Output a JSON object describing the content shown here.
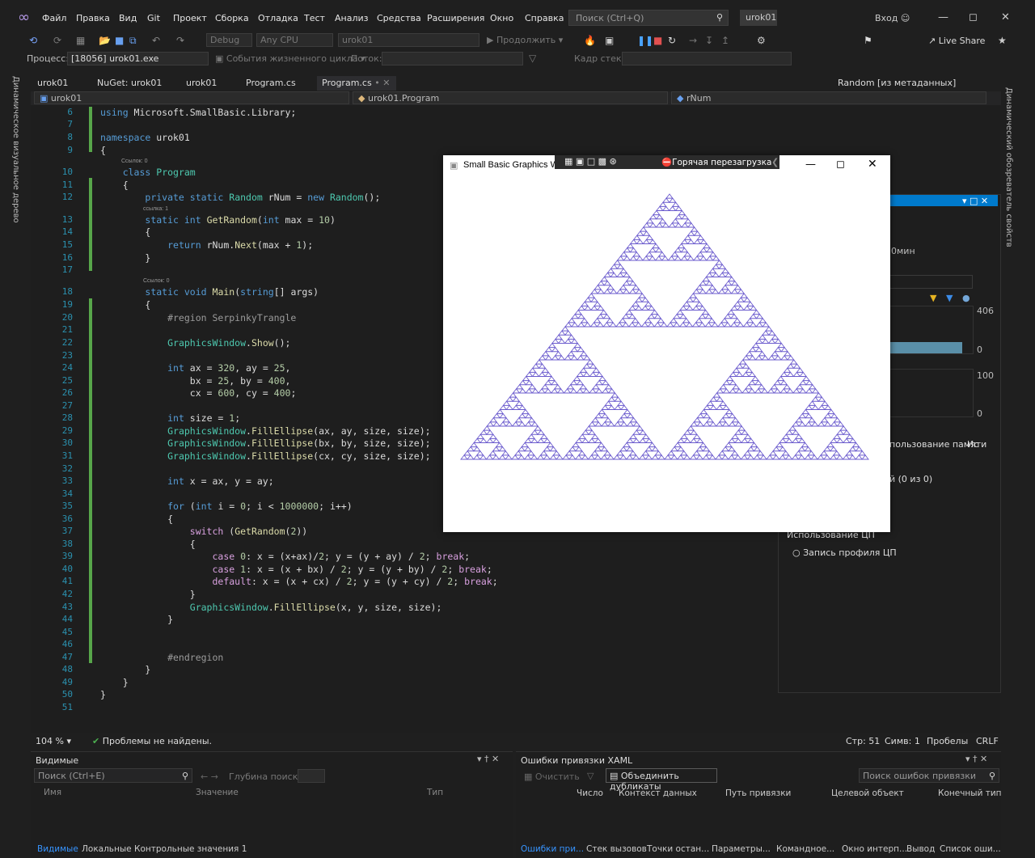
{
  "titlebar": {
    "menu": [
      "Файл",
      "Правка",
      "Вид",
      "Git",
      "Проект",
      "Сборка",
      "Отладка",
      "Тест",
      "Анализ",
      "Средства",
      "Расширения",
      "Окно",
      "Справка"
    ],
    "search_placeholder": "Поиск (Ctrl+Q)",
    "solution": "urok01",
    "signin": "Вход"
  },
  "toolbar": {
    "config": "Debug",
    "platform": "Any CPU",
    "startup": "urok01",
    "continue": "Продолжить",
    "live_share": "Live Share",
    "process_label": "Процесс:",
    "process_value": "[18056] urok01.exe",
    "lifecycle": "События жизненного цикла",
    "thread_label": "Поток:",
    "stackframe_label": "Кадр стека:"
  },
  "side": {
    "left_label": "Динамическое визуальное дерево",
    "right_label": "Динамический обозреватель свойств"
  },
  "tabs": [
    "urok01",
    "NuGet: urok01",
    "urok01",
    "Program.cs",
    "Program.cs"
  ],
  "tab_random": "Random [из метаданных]",
  "nav": {
    "project": "urok01",
    "class": "urok01.Program",
    "member": "rNum"
  },
  "code_lines": [
    {
      "n": "6",
      "t": "using Microsoft.SmallBasic.Library;"
    },
    {
      "n": "7",
      "t": ""
    },
    {
      "n": "8",
      "t": "namespace urok01"
    },
    {
      "n": "9",
      "t": "{"
    },
    {
      "n": "10",
      "t": "    class Program"
    },
    {
      "n": "11",
      "t": "    {"
    },
    {
      "n": "12",
      "t": "        private static Random rNum = new Random();"
    },
    {
      "n": "13",
      "t": "        static int GetRandom(int max = 10)"
    },
    {
      "n": "14",
      "t": "        {"
    },
    {
      "n": "15",
      "t": "            return rNum.Next(max + 1);"
    },
    {
      "n": "16",
      "t": "        }"
    },
    {
      "n": "17",
      "t": ""
    },
    {
      "n": "18",
      "t": "        static void Main(string[] args)"
    },
    {
      "n": "19",
      "t": "        {"
    },
    {
      "n": "20",
      "t": "            #region SerpinkyTrangle"
    },
    {
      "n": "21",
      "t": ""
    },
    {
      "n": "22",
      "t": "            GraphicsWindow.Show();"
    },
    {
      "n": "23",
      "t": ""
    },
    {
      "n": "24",
      "t": "            int ax = 320, ay = 25,"
    },
    {
      "n": "25",
      "t": "                bx = 25, by = 400,"
    },
    {
      "n": "26",
      "t": "                cx = 600, cy = 400;"
    },
    {
      "n": "27",
      "t": ""
    },
    {
      "n": "28",
      "t": "            int size = 1;"
    },
    {
      "n": "29",
      "t": "            GraphicsWindow.FillEllipse(ax, ay, size, size);"
    },
    {
      "n": "30",
      "t": "            GraphicsWindow.FillEllipse(bx, by, size, size);"
    },
    {
      "n": "31",
      "t": "            GraphicsWindow.FillEllipse(cx, cy, size, size);"
    },
    {
      "n": "32",
      "t": ""
    },
    {
      "n": "33",
      "t": "            int x = ax, y = ay;"
    },
    {
      "n": "34",
      "t": ""
    },
    {
      "n": "35",
      "t": "            for (int i = 0; i < 1000000; i++)"
    },
    {
      "n": "36",
      "t": "            {"
    },
    {
      "n": "37",
      "t": "                switch (GetRandom(2))"
    },
    {
      "n": "38",
      "t": "                {"
    },
    {
      "n": "39",
      "t": "                    case 0: x = (x+ax)/2; y = (y + ay) / 2; break;"
    },
    {
      "n": "40",
      "t": "                    case 1: x = (x + bx) / 2; y = (y + by) / 2; break;"
    },
    {
      "n": "41",
      "t": "                    default: x = (x + cx) / 2; y = (y + cy) / 2; break;"
    },
    {
      "n": "42",
      "t": "                }"
    },
    {
      "n": "43",
      "t": "                GraphicsWindow.FillEllipse(x, y, size, size);"
    },
    {
      "n": "44",
      "t": "            }"
    },
    {
      "n": "45",
      "t": ""
    },
    {
      "n": "46",
      "t": ""
    },
    {
      "n": "47",
      "t": "            #endregion"
    },
    {
      "n": "48",
      "t": "        }"
    },
    {
      "n": "49",
      "t": "    }"
    },
    {
      "n": "50",
      "t": "}"
    },
    {
      "n": "51",
      "t": ""
    }
  ],
  "refs": {
    "r10": "Ссылок: 0",
    "r12": "ссылка: 1",
    "r18": "Ссылок: 0"
  },
  "status": {
    "zoom": "104 %",
    "problems": "Проблемы не найдены.",
    "line": "Стр: 51",
    "col": "Симв: 1",
    "ws": "Пробелы",
    "eol": "CRLF"
  },
  "gfx": {
    "title": "Small Basic Graphics Wi",
    "hot_reload": "Горячая перезагрузка",
    "fill_color": "#6a5acd"
  },
  "diag": {
    "min": "0мин",
    "v406": "406",
    "v0a": "0",
    "v100": "100",
    "v0b": "0",
    "mem": "пользование памяти",
    "io": "Ис",
    "objs": "й (0 из 0)",
    "cpu_header": "Использование ЦП",
    "cpu_record": "Запись профиля ЦП"
  },
  "watch": {
    "title": "Видимые",
    "search": "Поиск (Ctrl+E)",
    "depth": "Глубина поиска:",
    "cols": [
      "Имя",
      "Значение",
      "Тип"
    ],
    "tabs": [
      "Видимые",
      "Локальные",
      "Контрольные значения 1"
    ]
  },
  "xaml": {
    "title": "Ошибки привязки XAML",
    "clear": "Очистить",
    "merge": "Объединить дубликаты",
    "search": "Поиск ошибок привязки",
    "cols": [
      "Число",
      "Контекст данных",
      "Путь привязки",
      "Целевой объект",
      "Конечный тип"
    ],
    "tabs": [
      "Ошибки при...",
      "Стек вызовов",
      "Точки остан...",
      "Параметры...",
      "Командное...",
      "Окно интерп...",
      "Вывод",
      "Список оши..."
    ]
  }
}
